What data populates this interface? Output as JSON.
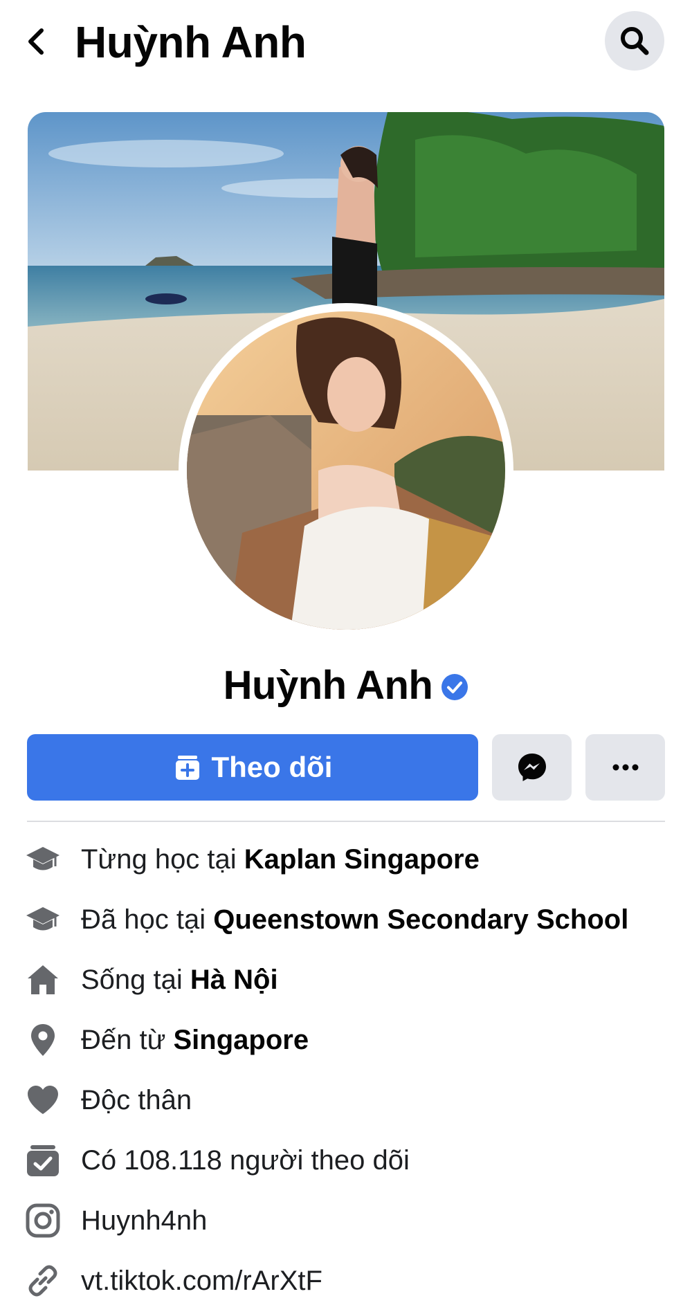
{
  "header": {
    "title": "Huỳnh Anh"
  },
  "profile": {
    "name": "Huỳnh Anh"
  },
  "actions": {
    "follow_label": "Theo dõi"
  },
  "intro": [
    {
      "icon": "graduation-cap-icon",
      "prefix": "Từng học tại ",
      "strong": "Kaplan Singapore"
    },
    {
      "icon": "graduation-cap-icon",
      "prefix": "Đã học tại ",
      "strong": "Queenstown Secondary School"
    },
    {
      "icon": "home-icon",
      "prefix": "Sống tại ",
      "strong": "Hà Nội"
    },
    {
      "icon": "location-pin-icon",
      "prefix": "Đến từ ",
      "strong": "Singapore"
    },
    {
      "icon": "heart-icon",
      "prefix": "Độc thân",
      "strong": ""
    },
    {
      "icon": "followers-icon",
      "prefix": "Có 108.118 người theo dõi",
      "strong": ""
    },
    {
      "icon": "instagram-icon",
      "prefix": "Huynh4nh",
      "strong": ""
    },
    {
      "icon": "link-icon",
      "prefix": "vt.tiktok.com/rArXtF",
      "strong": ""
    }
  ],
  "colors": {
    "accent": "#3a76e8",
    "button_gray": "#e4e6eb",
    "icon_gray": "#65676b"
  }
}
